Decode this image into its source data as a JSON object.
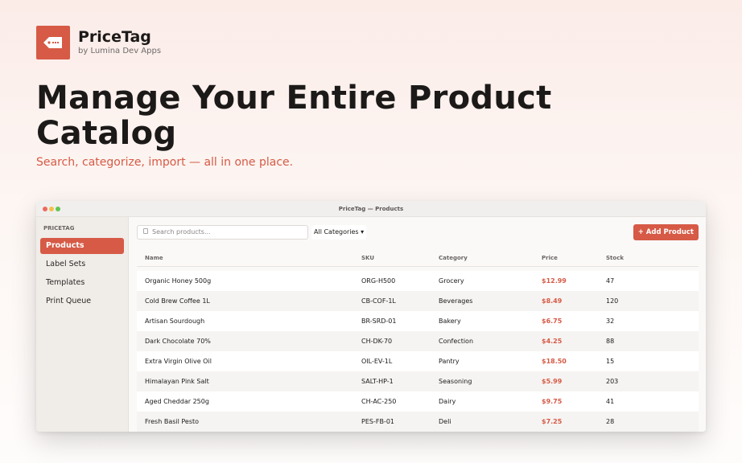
{
  "brand": {
    "name": "PriceTag",
    "subtitle": "by Lumina Dev Apps",
    "logo_icon": "price-tag-icon",
    "accent_color": "#d65a46"
  },
  "hero": {
    "headline": "Manage Your Entire Product Catalog",
    "tagline": "Search, categorize, import — all in one place."
  },
  "window": {
    "title": "PriceTag — Products"
  },
  "sidebar": {
    "heading": "PRICETAG",
    "items": [
      {
        "label": "Products",
        "active": true
      },
      {
        "label": "Label Sets",
        "active": false
      },
      {
        "label": "Templates",
        "active": false
      },
      {
        "label": "Print Queue",
        "active": false
      }
    ]
  },
  "toolbar": {
    "search_placeholder": "Search products...",
    "search_icon": "search-icon",
    "category_filter": "All Categories ▾",
    "add_label": "+  Add Product"
  },
  "table": {
    "columns": [
      "Name",
      "SKU",
      "Category",
      "Price",
      "Stock"
    ],
    "rows": [
      {
        "name": "Organic Honey 500g",
        "sku": "ORG-H500",
        "category": "Grocery",
        "price": "$12.99",
        "stock": "47"
      },
      {
        "name": "Cold Brew Coffee 1L",
        "sku": "CB-COF-1L",
        "category": "Beverages",
        "price": "$8.49",
        "stock": "120"
      },
      {
        "name": "Artisan Sourdough",
        "sku": "BR-SRD-01",
        "category": "Bakery",
        "price": "$6.75",
        "stock": "32"
      },
      {
        "name": "Dark Chocolate 70%",
        "sku": "CH-DK-70",
        "category": "Confection",
        "price": "$4.25",
        "stock": "88"
      },
      {
        "name": "Extra Virgin Olive Oil",
        "sku": "OIL-EV-1L",
        "category": "Pantry",
        "price": "$18.50",
        "stock": "15"
      },
      {
        "name": "Himalayan Pink Salt",
        "sku": "SALT-HP-1",
        "category": "Seasoning",
        "price": "$5.99",
        "stock": "203"
      },
      {
        "name": "Aged Cheddar 250g",
        "sku": "CH-AC-250",
        "category": "Dairy",
        "price": "$9.75",
        "stock": "41"
      },
      {
        "name": "Fresh Basil Pesto",
        "sku": "PES-FB-01",
        "category": "Deli",
        "price": "$7.25",
        "stock": "28"
      }
    ]
  }
}
